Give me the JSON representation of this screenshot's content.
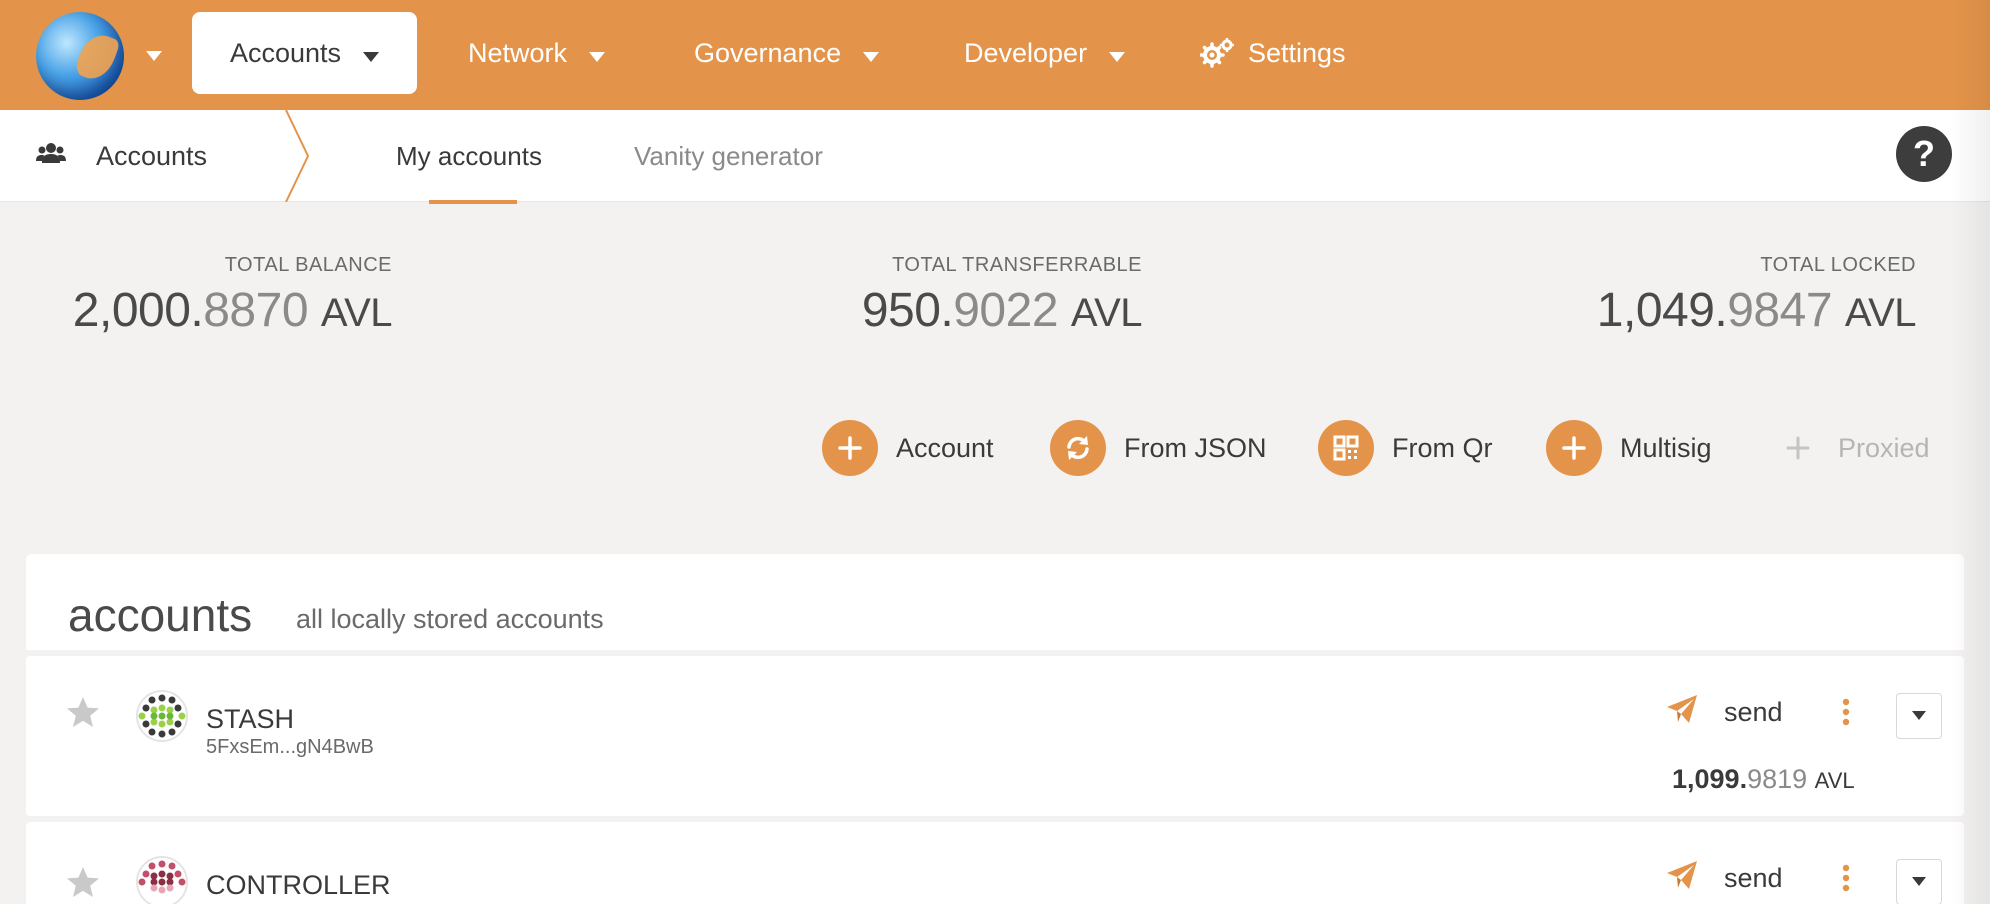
{
  "nav": {
    "items": [
      {
        "label": "Accounts",
        "active": true
      },
      {
        "label": "Network"
      },
      {
        "label": "Governance"
      },
      {
        "label": "Developer"
      },
      {
        "label": "Settings"
      }
    ]
  },
  "subnav": {
    "section": "Accounts",
    "tabs": [
      {
        "label": "My accounts",
        "active": true
      },
      {
        "label": "Vanity generator"
      }
    ],
    "help": "?"
  },
  "totals": {
    "balance": {
      "label": "TOTAL BALANCE",
      "int": "2,000.",
      "dec": "8870",
      "unit": "AVL"
    },
    "transferrable": {
      "label": "TOTAL TRANSFERRABLE",
      "int": "950.",
      "dec": "9022",
      "unit": "AVL"
    },
    "locked": {
      "label": "TOTAL LOCKED",
      "int": "1,049.",
      "dec": "9847",
      "unit": "AVL"
    }
  },
  "actions": [
    {
      "label": "Account",
      "icon": "plus-icon"
    },
    {
      "label": "From JSON",
      "icon": "sync-icon"
    },
    {
      "label": "From Qr",
      "icon": "qrcode-icon"
    },
    {
      "label": "Multisig",
      "icon": "plus-icon"
    },
    {
      "label": "Proxied",
      "icon": "plus-icon",
      "disabled": true
    }
  ],
  "accounts_panel": {
    "title": "accounts",
    "subtitle": "all locally stored accounts"
  },
  "accounts": [
    {
      "name": "STASH",
      "address": "5FxsEm...gN4BwB",
      "send_label": "send",
      "balance": {
        "int": "1,099.",
        "dec": "9819",
        "unit": "AVL"
      }
    },
    {
      "name": "CONTROLLER",
      "send_label": "send"
    }
  ],
  "colors": {
    "accent": "#e4944a",
    "background": "#f3f2f1",
    "text": "#4a4a4a"
  }
}
